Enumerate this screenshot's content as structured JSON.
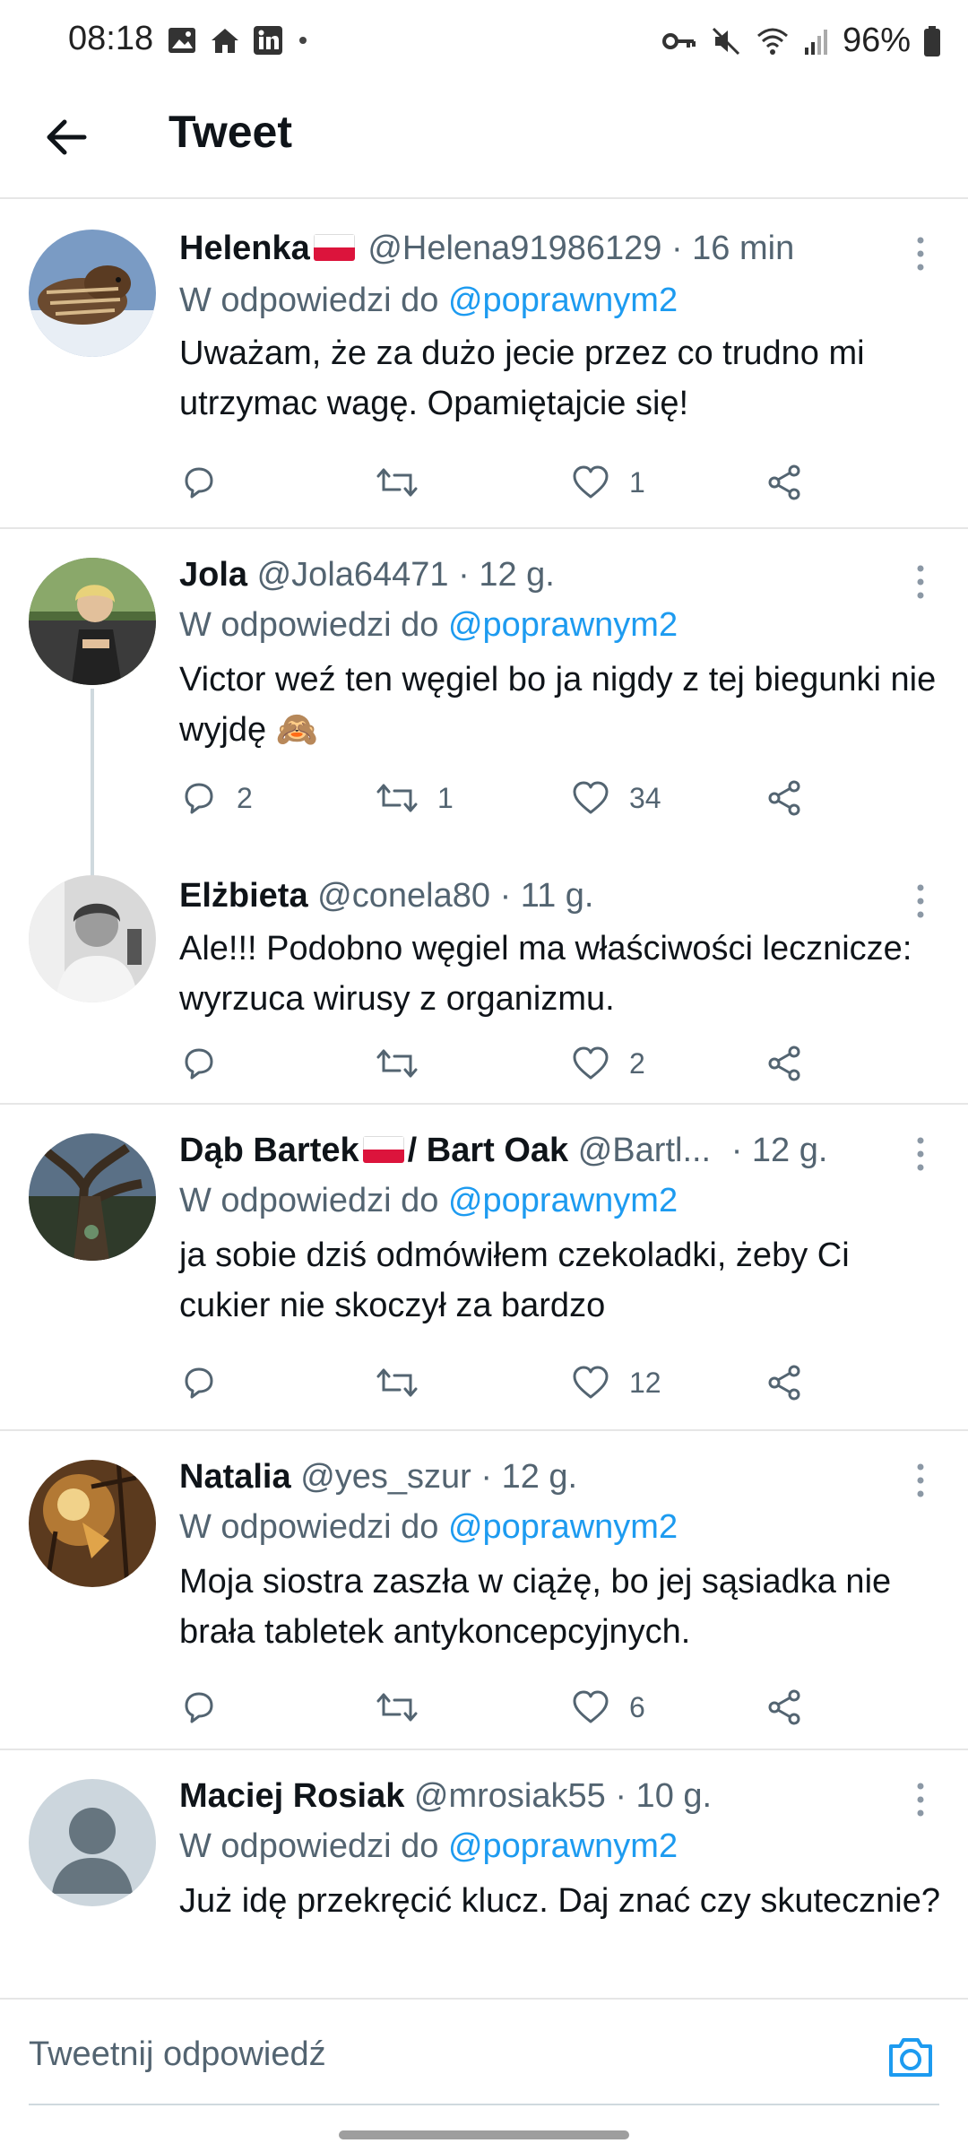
{
  "status_bar": {
    "time": "08:18",
    "battery": "96%"
  },
  "header": {
    "title": "Tweet"
  },
  "tweets": [
    {
      "name": "Helenka",
      "handle": "@Helena91986129",
      "time": "· 16 min",
      "reply_prefix": "W odpowiedzi do",
      "reply_mention": "@poprawnym2",
      "text": "Uważam, że za dużo jecie przez co trudno mi utrzymac wagę. Opamiętajcie się!",
      "replies": "",
      "retweets": "",
      "likes": "1"
    },
    {
      "name": "Jola",
      "handle": "@Jola64471",
      "time": "· 12 g.",
      "reply_prefix": "W odpowiedzi do",
      "reply_mention": "@poprawnym2",
      "text": "Victor weź ten węgiel bo ja nigdy z tej biegunki nie wyjdę 🙈",
      "replies": "2",
      "retweets": "1",
      "likes": "34"
    },
    {
      "name": "Elżbieta",
      "handle": "@conela80",
      "time": "· 11 g.",
      "text": "Ale!!! Podobno węgiel ma właściwości lecznicze: wyrzuca wirusy z organizmu.",
      "replies": "",
      "retweets": "",
      "likes": "2"
    },
    {
      "name_part1": "Dąb Bartek",
      "name_part2": "/ Bart Oak",
      "handle": "@Bartl...",
      "time": "· 12 g.",
      "reply_prefix": "W odpowiedzi do",
      "reply_mention": "@poprawnym2",
      "text": "ja sobie dziś odmówiłem czekoladki, żeby Ci cukier nie skoczył za bardzo",
      "replies": "",
      "retweets": "",
      "likes": "12"
    },
    {
      "name": "Natalia",
      "handle": "@yes_szur",
      "time": "· 12 g.",
      "reply_prefix": "W odpowiedzi do",
      "reply_mention": "@poprawnym2",
      "text": "Moja siostra zaszła w ciążę, bo jej sąsiadka nie brała tabletek antykoncepcyjnych.",
      "replies": "",
      "retweets": "",
      "likes": "6"
    },
    {
      "name": "Maciej Rosiak",
      "handle": "@mrosiak55",
      "time": "· 10 g.",
      "reply_prefix": "W odpowiedzi do",
      "reply_mention": "@poprawnym2",
      "text": "Już idę przekręcić klucz.  Daj znać czy skutecznie?"
    }
  ],
  "composer": {
    "placeholder": "Tweetnij odpowiedź"
  },
  "colors": {
    "link": "#1d9bf0",
    "muted": "#536471",
    "text": "#0f1419",
    "divider": "#e6e6e6"
  }
}
